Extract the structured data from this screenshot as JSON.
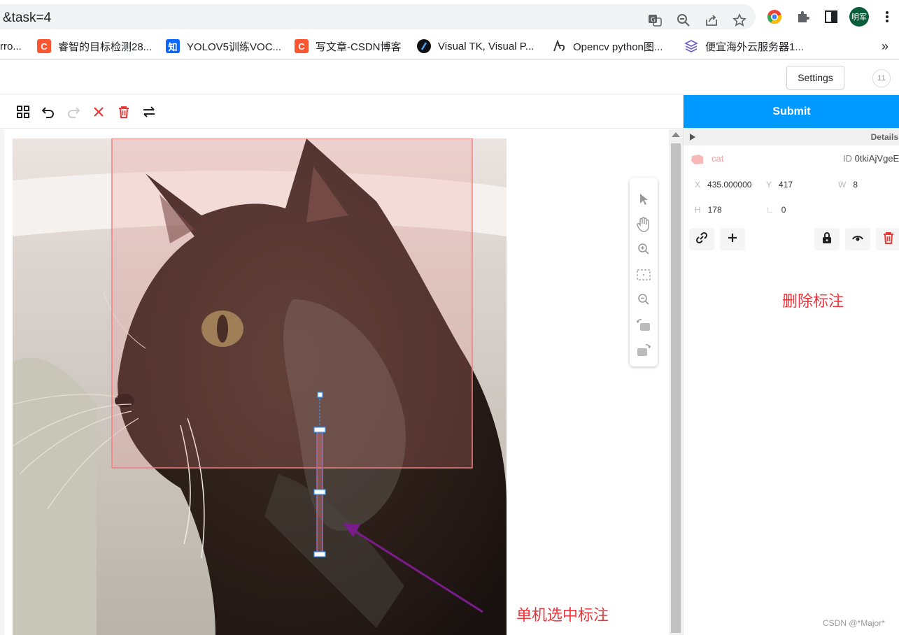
{
  "browser": {
    "address": "&task=4",
    "avatar_text": "明军",
    "bookmarks": [
      {
        "label": "rro...",
        "icon": "none"
      },
      {
        "label": "睿智的目标检测28...",
        "icon": "csdn-icon"
      },
      {
        "label": "YOLOV5训练VOC...",
        "icon": "zhihu-icon"
      },
      {
        "label": "写文章-CSDN博客",
        "icon": "csdn-icon"
      },
      {
        "label": "Visual TK, Visual P...",
        "icon": "visualtk-icon"
      },
      {
        "label": "Opencv python图...",
        "icon": "opencv-icon"
      },
      {
        "label": "便宜海外云服务器1...",
        "icon": "cloud-icon"
      }
    ],
    "zhihu_glyph": "知",
    "csdn_glyph": "C",
    "more": "»"
  },
  "app": {
    "settings_label": "Settings",
    "badge": "11"
  },
  "panel": {
    "submit_label": "Submit",
    "details_label": "Details",
    "region": {
      "label": "cat",
      "id_prefix": "ID",
      "id_value": "0tkiAjVgeE",
      "x_label": "X",
      "x_value": "435.000000",
      "y_label": "Y",
      "y_value": "417",
      "w_label": "W",
      "w_value": "8",
      "h_label": "H",
      "h_value": "178",
      "angle_label": "∟",
      "angle_value": "0"
    }
  },
  "annotations": {
    "delete_note": "删除标注",
    "select_note": "单机选中标注"
  },
  "watermark": "CSDN @*Major*",
  "colors": {
    "submit": "#0099ff",
    "annotation_text": "#e8353b",
    "arrow": "#7b1c8c",
    "bbox": "#f08080"
  }
}
